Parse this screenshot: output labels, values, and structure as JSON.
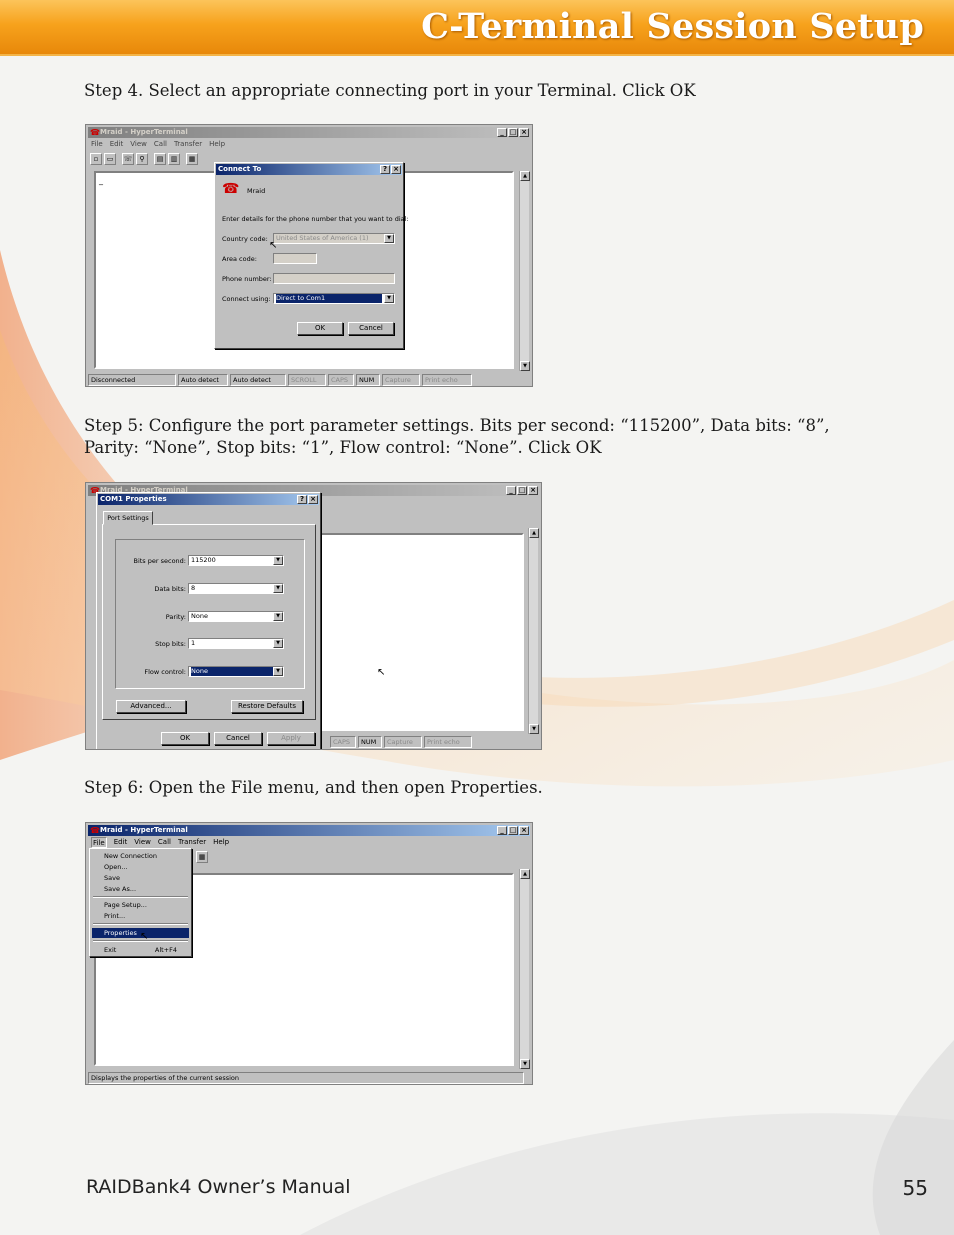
{
  "header": {
    "title": "C-Terminal Session Setup"
  },
  "steps": {
    "step4": "Step 4. Select an appropriate connecting port in your Terminal. Click OK",
    "step5_line1": "Step 5: Configure the port parameter settings. Bits per second: “115200”, Data bits: “8”,",
    "step5_line2": "Parity: “None”, Stop bits: “1”, Flow control: “None”. Click OK",
    "step6": "Step 6: Open the File menu, and then open Properties."
  },
  "app": {
    "window_title": "Mraid - HyperTerminal",
    "menus": [
      "File",
      "Edit",
      "View",
      "Call",
      "Transfer",
      "Help"
    ],
    "status_bar": [
      "Disconnected",
      "Auto detect",
      "Auto detect",
      "SCROLL",
      "CAPS",
      "NUM",
      "Capture",
      "Print echo"
    ]
  },
  "connect_dialog": {
    "title": "Connect To",
    "connection_name": "Mraid",
    "instructions": "Enter details for the phone number that you want to dial:",
    "country_label": "Country code:",
    "country_value": "United States of America (1)",
    "area_label": "Area code:",
    "phone_label": "Phone number:",
    "connect_using_label": "Connect using:",
    "connect_using_value": "Direct to Com1",
    "ok": "OK",
    "cancel": "Cancel"
  },
  "com_dialog": {
    "title": "COM1 Properties",
    "tab": "Port Settings",
    "bits_label": "Bits per second:",
    "bits_value": "115200",
    "data_label": "Data bits:",
    "data_value": "8",
    "parity_label": "Parity:",
    "parity_value": "None",
    "stop_label": "Stop bits:",
    "stop_value": "1",
    "flow_label": "Flow control:",
    "flow_value": "None",
    "advanced": "Advanced...",
    "restore": "Restore Defaults",
    "ok": "OK",
    "cancel": "Cancel",
    "apply": "Apply",
    "status_visible": [
      "CAPS",
      "NUM",
      "Capture",
      "Print echo"
    ]
  },
  "file_menu": {
    "items": [
      "New Connection",
      "Open...",
      "Save",
      "Save As...",
      "Page Setup...",
      "Print...",
      "Properties",
      "Exit"
    ],
    "exit_shortcut": "Alt+F4",
    "status_text": "Displays the properties of the current session"
  },
  "footer": {
    "manual": "RAIDBank4 Owner’s Manual",
    "page": "55"
  }
}
